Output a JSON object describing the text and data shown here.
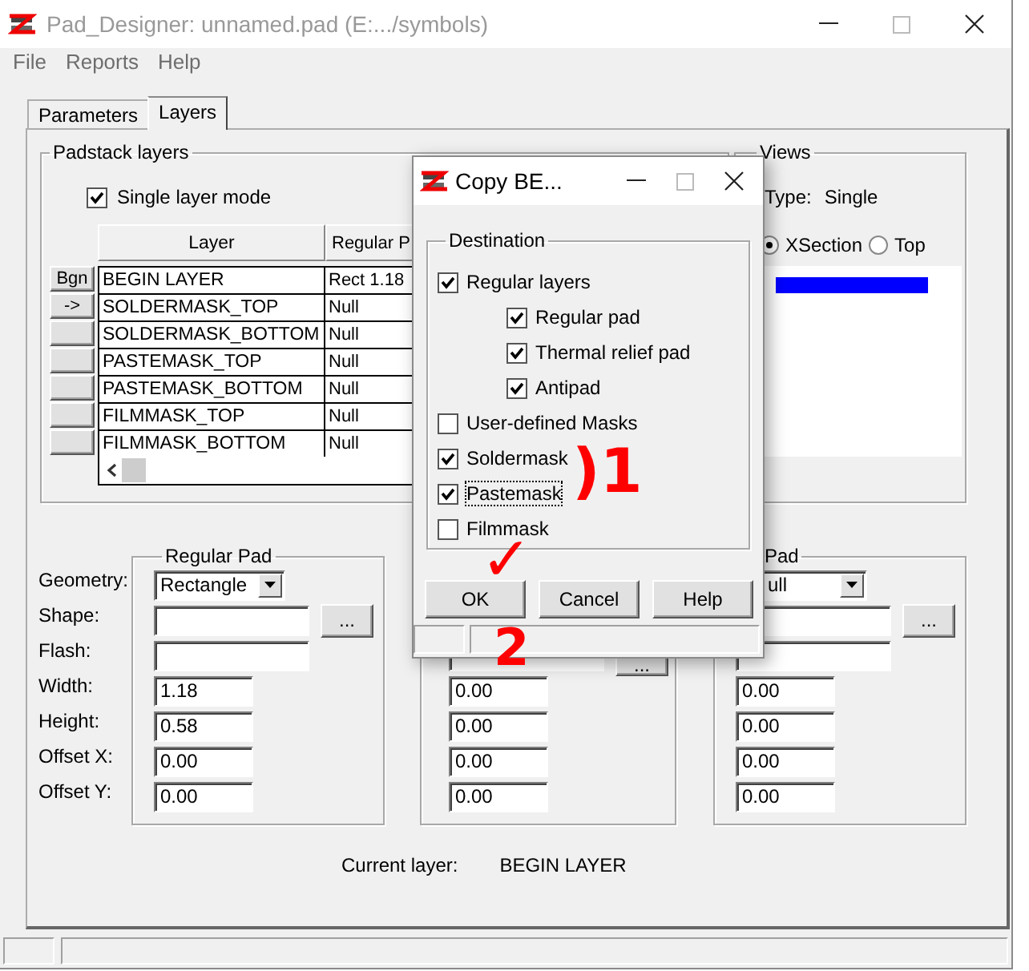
{
  "window": {
    "title": "Pad_Designer: unnamed.pad  (E:.../symbols)"
  },
  "menu": [
    {
      "label": "File",
      "disabled": true
    },
    {
      "label": "Reports",
      "disabled": true
    },
    {
      "label": "Help",
      "disabled": true
    }
  ],
  "tabs": [
    {
      "label": "Parameters",
      "selected": false
    },
    {
      "label": "Layers",
      "selected": true
    }
  ],
  "padstack_layers": {
    "title": "Padstack layers",
    "single_layer_mode": {
      "label": "Single layer mode",
      "checked": true
    },
    "columns": [
      "Layer",
      "Regular P"
    ],
    "rows": [
      {
        "button": "Bgn",
        "layer": "BEGIN LAYER",
        "regular_pad": "Rect 1.18"
      },
      {
        "button": "->",
        "layer": "SOLDERMASK_TOP",
        "regular_pad": "Null"
      },
      {
        "layer": "SOLDERMASK_BOTTOM",
        "regular_pad": "Null"
      },
      {
        "layer": "PASTEMASK_TOP",
        "regular_pad": "Null"
      },
      {
        "layer": "PASTEMASK_BOTTOM",
        "regular_pad": "Null"
      },
      {
        "layer": "FILMMASK_TOP",
        "regular_pad": "Null"
      },
      {
        "layer": "FILMMASK_BOTTOM",
        "regular_pad": "Null"
      }
    ]
  },
  "views": {
    "title": "Views",
    "type_label": "Type:",
    "type_value": "Single",
    "options": [
      {
        "label": "XSection",
        "selected": true
      },
      {
        "label": "Top",
        "selected": false
      }
    ]
  },
  "field_labels": [
    "Geometry:",
    "Shape:",
    "Flash:",
    "Width:",
    "Height:",
    "Offset X:",
    "Offset Y:"
  ],
  "pad_groups": [
    {
      "title": "Regular Pad",
      "rows": [
        {
          "kind": "geometry",
          "value": "Rectangle"
        },
        {
          "kind": "field",
          "button": "..."
        },
        {
          "kind": "field"
        },
        {
          "kind": "field",
          "value": "1.18"
        },
        {
          "kind": "field",
          "value": "0.58"
        },
        {
          "kind": "field",
          "value": "0.00"
        },
        {
          "kind": "field",
          "value": "0.00"
        }
      ]
    },
    {
      "rows": [
        {
          "kind": "covered"
        },
        {
          "kind": "covered"
        },
        {
          "kind": "field",
          "button": "..."
        },
        {
          "kind": "field",
          "value": "0.00"
        },
        {
          "kind": "field",
          "value": "0.00"
        },
        {
          "kind": "field",
          "value": "0.00"
        },
        {
          "kind": "field",
          "value": "0.00"
        }
      ]
    },
    {
      "title": "Pad",
      "rows": [
        {
          "kind": "geometry",
          "value": "ull"
        },
        {
          "kind": "field",
          "button": "..."
        },
        {
          "kind": "field"
        },
        {
          "kind": "field",
          "value": "0.00"
        },
        {
          "kind": "field",
          "value": "0.00"
        },
        {
          "kind": "field",
          "value": "0.00"
        },
        {
          "kind": "field",
          "value": "0.00"
        }
      ]
    }
  ],
  "current_layer": {
    "label": "Current layer:",
    "value": "BEGIN LAYER"
  },
  "dialog": {
    "title": "Copy BE...",
    "group_title": "Destination",
    "options": [
      {
        "label": "Regular layers",
        "checked": true,
        "focused": false,
        "children": [
          {
            "label": "Regular pad",
            "checked": true,
            "focused": false
          },
          {
            "label": "Thermal relief pad",
            "checked": true,
            "focused": false
          },
          {
            "label": "Antipad",
            "checked": true,
            "focused": false
          }
        ]
      },
      {
        "label": "User-defined Masks",
        "checked": false,
        "focused": false
      },
      {
        "label": "Soldermask",
        "checked": true,
        "focused": false
      },
      {
        "label": "Pastemask",
        "checked": true,
        "focused": true
      },
      {
        "label": "Filmmask",
        "checked": false,
        "focused": false
      }
    ],
    "buttons": [
      "OK",
      "Cancel",
      "Help"
    ]
  },
  "annotations": [
    {
      "text": ")1"
    },
    {
      "text": "✓"
    },
    {
      "text": "2"
    }
  ]
}
